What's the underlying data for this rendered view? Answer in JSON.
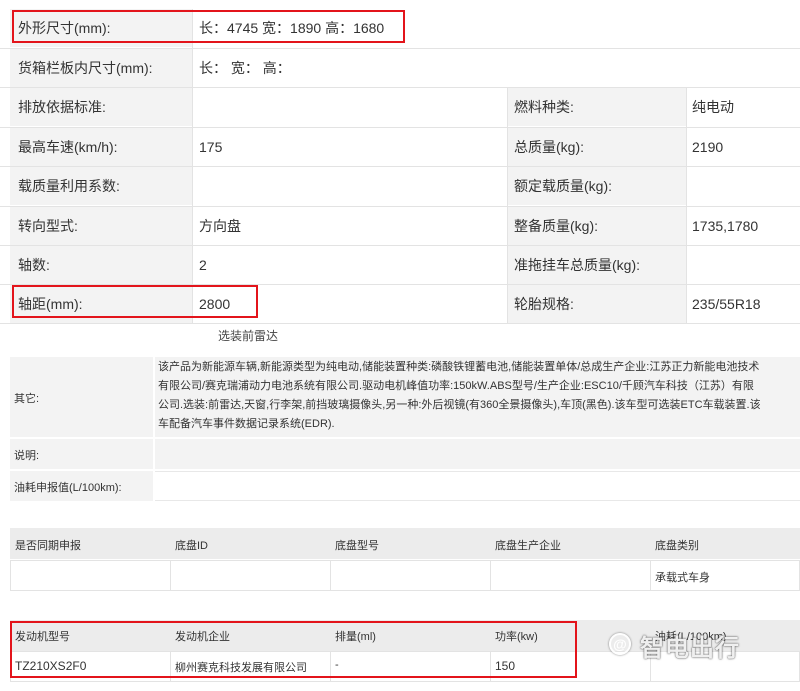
{
  "spec": {
    "dimensions_label": "外形尺寸(mm):",
    "dimensions_value": "长：4745 宽：1890 高：1680",
    "cargo_label": "货箱栏板内尺寸(mm):",
    "cargo_value": "长：  宽：  高：",
    "emission_label": "排放依据标准:",
    "emission_value": "",
    "fuel_label": "燃料种类:",
    "fuel_value": "纯电动",
    "speed_label": "最高车速(km/h):",
    "speed_value": "175",
    "total_mass_label": "总质量(kg):",
    "total_mass_value": "2190",
    "load_coef_label": "载质量利用系数:",
    "load_coef_value": "",
    "rated_load_label": "额定载质量(kg):",
    "rated_load_value": "",
    "steering_label": "转向型式:",
    "steering_value": "方向盘",
    "curb_label": "整备质量(kg):",
    "curb_value": "1735,1780",
    "axles_label": "轴数:",
    "axles_value": "2",
    "trailer_label": "准拖挂车总质量(kg):",
    "trailer_value": "",
    "wheelbase_label": "轴距(mm):",
    "wheelbase_value": "2800",
    "tire_label": "轮胎规格:",
    "tire_value": "235/55R18"
  },
  "middle_caption": "选装前雷达",
  "other": {
    "label": "其它:",
    "lines": [
      "该产品为新能源车辆,新能源类型为纯电动,储能装置种类:磷酸铁锂蓄电池,储能装置单体/总成生产企业:江苏正力新能电池技术",
      "有限公司/赛克瑞浦动力电池系统有限公司.驱动电机峰值功率:150kW.ABS型号/生产企业:ESC10/千顾汽车科技（江苏）有限",
      "公司.选装:前雷达,天窗,行李架,前挡玻璃摄像头,另一种:外后视镜(有360全景摄像头),车顶(黑色).该车型可选装ETC车载装置.该",
      "车配备汽车事件数据记录系统(EDR)."
    ],
    "explain_label": "说明:",
    "fuel_report_label": "油耗申报值(L/100km):"
  },
  "chassis": {
    "headers": [
      "是否同期申报",
      "底盘ID",
      "底盘型号",
      "底盘生产企业",
      "底盘类别"
    ],
    "row": [
      "",
      "",
      "",
      "",
      "承载式车身"
    ]
  },
  "engine": {
    "headers": [
      "发动机型号",
      "发动机企业",
      "排量(ml)",
      "功率(kw)",
      "油耗(L/100km)"
    ],
    "row": [
      "TZ210XS2F0",
      "柳州赛克科技发展有限公司",
      "-",
      "150",
      ""
    ]
  },
  "watermark": "智电出行",
  "colors": {
    "highlight": "#e3141b",
    "label_bg": "#f3f3f3",
    "grid": "#e3e3e3"
  }
}
